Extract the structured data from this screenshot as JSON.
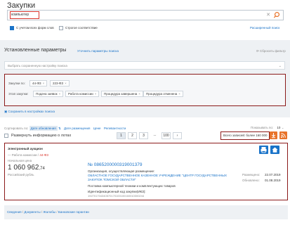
{
  "header": {
    "title": "Закупки",
    "search_value": "компьютер",
    "checkbox_forms": "С учетом всех форм слов",
    "checkbox_strict": "Строгое соответствие",
    "advanced_search": "Расширенный поиск"
  },
  "params": {
    "title": "Установленные параметры",
    "update_link": "Уточнить параметры поиска",
    "reset_link": "Сбросить фильтр",
    "saved_placeholder": "Выбрать сохраненную настройку поиска",
    "law_label": "Закупки по:",
    "law_tags": [
      "44-ФЗ",
      "223-ФЗ"
    ],
    "stage_label": "Этап закупки:",
    "stages": [
      "Подача заявок",
      "Работа комиссии",
      "Процедура завершена",
      "Процедура отменена"
    ],
    "save_link": "Сохранить в настройках поиска"
  },
  "sort": {
    "label": "Сортировать по:",
    "options": [
      "Дате обновления",
      "Дате размещения",
      "Цене",
      "Релевантности"
    ],
    "active_index": 0,
    "perpage_label": "Показывать по:",
    "perpage_value": "10"
  },
  "toolbar": {
    "expand_label": "Развернуть информацию о лотах",
    "pages": [
      "1",
      "2",
      "3",
      "...",
      "100"
    ],
    "next": "›",
    "total": "Всего записей: более 160 000"
  },
  "record": {
    "type": "Электронный аукцион",
    "stage": "Работа комиссии",
    "law": "44-ФЗ",
    "price_label": "Начальная цена",
    "price_main": "1 060 962",
    "price_cents": ",74",
    "currency": "Российский рубль",
    "number": "№ 0865200000319001379",
    "org_label": "Организация, осуществляющая размещение:",
    "org_name": "ОБЛАСТНОЕ ГОСУДАРСТВЕННОЕ КАЗЕННОЕ УЧРЕЖДЕНИЕ \"ЦЕНТР ГОСУДАРСТВЕННЫХ ЗАКУПОК ТОМСКОЙ ОБЛАСТИ\"",
    "object": "Поставка компьютерной техники и комплектующих товаров",
    "ikz_label": "Идентификационный код закупки(ИКЗ):",
    "ikz_value": "192701704340570170100100160010000244",
    "placed_label": "Размещено:",
    "placed_date": "22.07.2019",
    "updated_label": "Обновлено:",
    "updated_date": "01.08.2019"
  },
  "footer_links": [
    "Сведения",
    "Документы",
    "Жалобы",
    "Банковские гарантии"
  ],
  "colors": {
    "accent": "#1a73c8",
    "highlight": "#8b1a1a",
    "orange": "#e8732a"
  }
}
